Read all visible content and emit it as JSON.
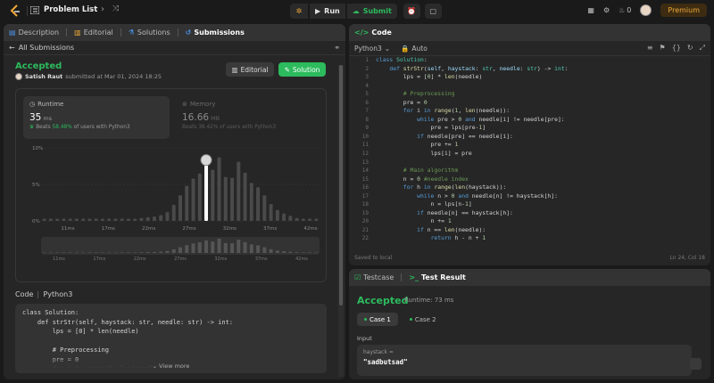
{
  "topbar": {
    "problem_list_label": "Problem List",
    "run_label": "Run",
    "submit_label": "Submit",
    "streak_count": "0",
    "premium_label": "Premium"
  },
  "left": {
    "tabs": [
      "Description",
      "Editorial",
      "Solutions",
      "Submissions"
    ],
    "back_label": "All Submissions",
    "status": "Accepted",
    "author": "Satish Raut",
    "submitted_text": "submitted at Mar 01, 2024 18:25",
    "editorial_button": "Editorial",
    "solution_button": "Solution",
    "runtime": {
      "label": "Runtime",
      "value": "35",
      "unit": "ms",
      "beats_prefix": "Beats",
      "beats_pct": "58.48%",
      "beats_suffix": "of users with Python3"
    },
    "memory": {
      "label": "Memory",
      "value": "16.66",
      "unit": "MB",
      "beats_text": "Beats 38.42% of users with Python3"
    },
    "code_label": "Code",
    "code_lang": "Python3",
    "code_snippet": "class Solution:\n    def strStr(self, haystack: str, needle: str) -> int:\n        lps = [0] * len(needle)\n\n        # Preprocessing\n        pre = 0\n        for i in range(1, len(needle)):\n            while pre > 0 and needle[i] != needle[pre]:",
    "view_more": "View more"
  },
  "chart_data": {
    "type": "bar",
    "title": "",
    "ylabel": "",
    "ylim": [
      0,
      10
    ],
    "y_ticks": [
      "0%",
      "5%",
      "10%"
    ],
    "x_ticks": [
      "11ms",
      "17ms",
      "22ms",
      "27ms",
      "32ms",
      "37ms",
      "42ms"
    ],
    "highlight_label": "35ms",
    "values": [
      0.3,
      0.3,
      0.3,
      0.3,
      0.3,
      0.3,
      0.3,
      0.3,
      0.3,
      0.3,
      0.3,
      0.3,
      0.3,
      0.3,
      0.3,
      0.4,
      0.5,
      0.6,
      0.8,
      1.2,
      2.2,
      3.5,
      4.8,
      5.8,
      6.5,
      7.6,
      7.0,
      8.7,
      6.0,
      5.9,
      8.1,
      6.6,
      5.2,
      4.6,
      3.5,
      2.3,
      1.5,
      1.0,
      0.7,
      0.4,
      0.3,
      0.3,
      0.3
    ],
    "highlight_index": 25,
    "mini_values": [
      0.3,
      0.3,
      0.3,
      0.3,
      0.3,
      0.3,
      0.3,
      0.3,
      0.3,
      0.3,
      0.3,
      0.3,
      0.3,
      0.3,
      0.3,
      0.4,
      0.5,
      0.6,
      0.8,
      1.2,
      2.2,
      3.5,
      4.8,
      5.8,
      6.5,
      7.6,
      7.0,
      8.7,
      6.0,
      5.9,
      8.1,
      6.6,
      5.2,
      4.6,
      3.5,
      2.3,
      1.5,
      1.0,
      0.7,
      0.4,
      0.3,
      0.3,
      0.3
    ]
  },
  "right_top": {
    "tab_label": "Code",
    "language": "Python3",
    "auto_label": "Auto",
    "saved_label": "Saved to local",
    "cursor_pos": "Ln 24, Col 18"
  },
  "right_bottom": {
    "tabs": [
      "Testcase",
      "Test Result"
    ],
    "status": "Accepted",
    "runtime_text": "Runtime: 73 ms",
    "cases": [
      "Case 1",
      "Case 2"
    ],
    "input_label": "Input",
    "input_name": "haystack =",
    "input_value": "\"sadbutsad\""
  },
  "colors": {
    "accent_green": "#2cbb5d",
    "premium": "#f0a937",
    "background": "#1a1a1a",
    "panel": "#262626"
  },
  "icons": [
    "logo-icon",
    "list-icon",
    "chevron-left-icon",
    "chevron-right-icon",
    "shuffle-icon",
    "bug-icon",
    "play-icon",
    "cloud-upload-icon",
    "alarm-icon",
    "note-icon",
    "grid-icon",
    "gear-icon",
    "fire-icon",
    "back-icon",
    "link-icon",
    "clock-icon",
    "chip-icon",
    "code-icon",
    "lock-icon",
    "bookmark-icon",
    "braces-icon",
    "reset-icon",
    "expand-icon"
  ]
}
